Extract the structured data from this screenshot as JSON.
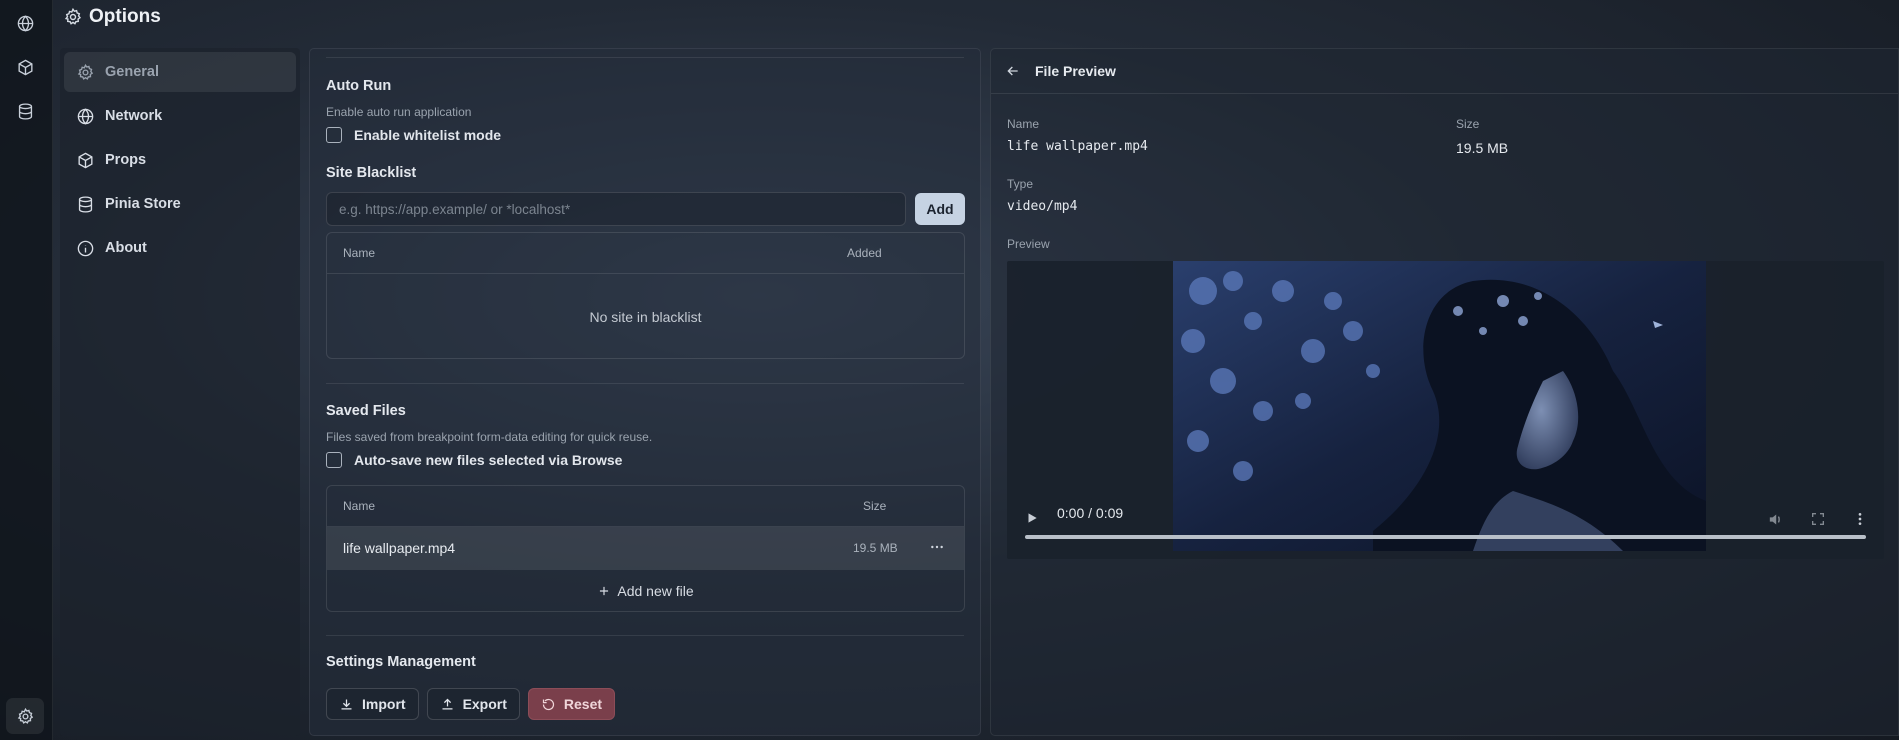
{
  "app": {
    "title": "Options"
  },
  "rail": {
    "icons": [
      "globe-icon",
      "cube-icon",
      "database-icon"
    ],
    "bottom_icon": "gear-icon"
  },
  "sidebar": {
    "items": [
      {
        "label": "General",
        "icon": "gear-icon",
        "active": true
      },
      {
        "label": "Network",
        "icon": "globe-icon"
      },
      {
        "label": "Props",
        "icon": "cube-icon"
      },
      {
        "label": "Pinia Store",
        "icon": "database-icon"
      },
      {
        "label": "About",
        "icon": "info-icon"
      }
    ]
  },
  "auto_run": {
    "title": "Auto Run",
    "description": "Enable auto run application",
    "whitelist_label": "Enable whitelist mode"
  },
  "site_blacklist": {
    "title": "Site Blacklist",
    "placeholder": "e.g. https://app.example/ or *localhost*",
    "add_label": "Add",
    "columns": {
      "name": "Name",
      "added": "Added"
    },
    "empty_text": "No site in blacklist"
  },
  "saved_files": {
    "title": "Saved Files",
    "description": "Files saved from breakpoint form-data editing for quick reuse.",
    "autosave_label": "Auto-save new files selected via Browse",
    "columns": {
      "name": "Name",
      "size": "Size"
    },
    "rows": [
      {
        "name": "life wallpaper.mp4",
        "size": "19.5 MB"
      }
    ],
    "add_new_label": "Add new file"
  },
  "settings_management": {
    "title": "Settings Management",
    "import_label": "Import",
    "export_label": "Export",
    "reset_label": "Reset"
  },
  "file_preview": {
    "title": "File Preview",
    "name_label": "Name",
    "name_value": "life wallpaper.mp4",
    "size_label": "Size",
    "size_value": "19.5 MB",
    "type_label": "Type",
    "type_value": "video/mp4",
    "preview_label": "Preview",
    "video": {
      "time": "0:00 / 0:09",
      "progress": 0
    }
  },
  "colors": {
    "reset_button": "#7a3f4b",
    "add_button": "#c6d3e3"
  }
}
